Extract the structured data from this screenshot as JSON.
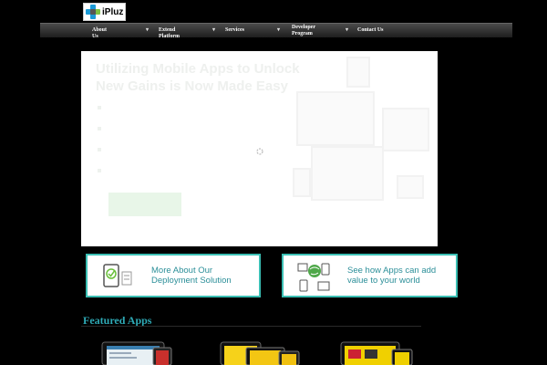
{
  "brand": {
    "logo_text": "iPluz"
  },
  "nav": {
    "items": [
      {
        "label": "About Us",
        "has_caret": true
      },
      {
        "label": "Extend Platform",
        "has_caret": true
      },
      {
        "label": "Services",
        "has_caret": true
      },
      {
        "label": "Developer Program",
        "has_caret": true
      },
      {
        "label": "Contact Us",
        "has_caret": false
      }
    ],
    "caret_glyph": "▾"
  },
  "banner": {
    "title": "Utilizing Mobile Apps to Unlock New Gains is Now Made Easy",
    "loading_icon": "spinner-icon"
  },
  "promos": [
    {
      "label": "More About Our Deployment Solution",
      "icon": "mobile-checklist-icon"
    },
    {
      "label": "See how Apps can add value to your world",
      "icon": "devices-globe-icon"
    }
  ],
  "featured": {
    "title": "Featured Apps"
  },
  "colors": {
    "accent": "#2ea9b5",
    "promo_border": "#3bbfb4",
    "nav_top": "#4a4a4a",
    "background": "#000000"
  }
}
